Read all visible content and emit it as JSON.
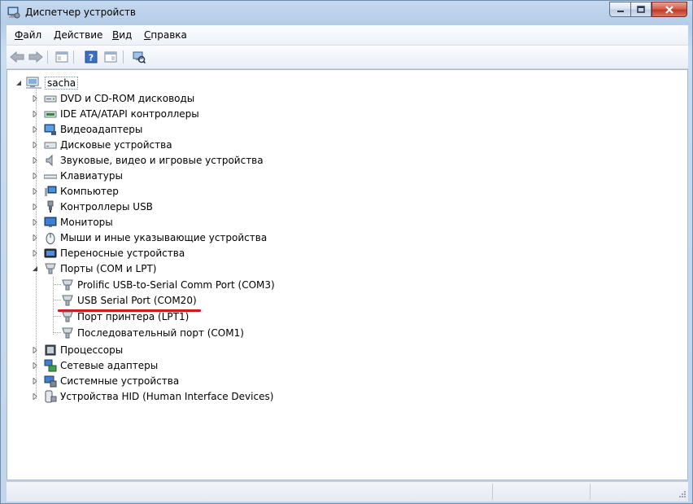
{
  "window": {
    "title": "Диспетчер устройств",
    "icons": [
      "device-manager-app-icon"
    ]
  },
  "caption": {
    "minimize_icon": "minimize-icon",
    "maximize_icon": "maximize-icon",
    "close_icon": "close-icon"
  },
  "menu": {
    "file": {
      "accel": "Ф",
      "rest": "айл"
    },
    "action": {
      "accel": "Д",
      "rest": "ействие"
    },
    "view": {
      "accel": "В",
      "rest": "ид"
    },
    "help": {
      "accel": "С",
      "rest": "правка"
    }
  },
  "toolbar": {
    "buttons": [
      "back-arrow-icon",
      "forward-arrow-icon",
      "show-hide-console-tree-icon",
      "help-icon",
      "properties-icon",
      "scan-hardware-icon"
    ]
  },
  "tree": {
    "root": "sacha",
    "categories": {
      "dvd": "DVD и CD-ROM дисководы",
      "ide": "IDE ATA/ATAPI контроллеры",
      "video": "Видеоадаптеры",
      "disk": "Дисковые устройства",
      "sound": "Звуковые, видео и игровые устройства",
      "keyboard": "Клавиатуры",
      "computer": "Компьютер",
      "usb": "Контроллеры USB",
      "monitors": "Мониторы",
      "mice": "Мыши и иные указывающие устройства",
      "portable": "Переносные устройства",
      "ports": "Порты (COM и LPT)",
      "cpu": "Процессоры",
      "network": "Сетевые адаптеры",
      "system": "Системные устройства",
      "hid": "Устройства HID (Human Interface Devices)"
    },
    "ports_children": {
      "prolific": "Prolific USB-to-Serial Comm Port (COM3)",
      "usbserial": "USB Serial Port (COM20)",
      "lpt": "Порт принтера (LPT1)",
      "com1": "Последовательный порт (COM1)"
    }
  },
  "accent": {
    "annotation_red": "#d31b1b",
    "selection_border": "#6a8fbf"
  }
}
